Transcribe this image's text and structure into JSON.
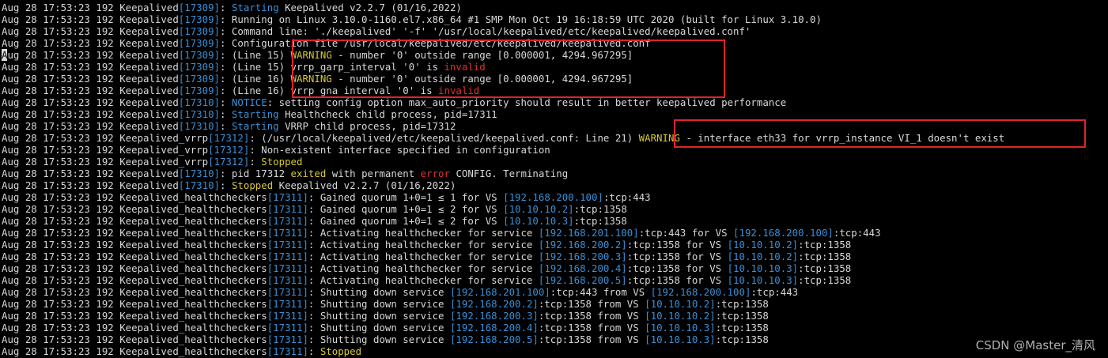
{
  "terminal": {
    "lines": [
      [
        {
          "t": "Aug 28 17:53:23 192 Keepalived",
          "c": "w"
        },
        {
          "t": "[17309]",
          "c": "b"
        },
        {
          "t": ": ",
          "c": "w"
        },
        {
          "t": "Starting",
          "c": "b"
        },
        {
          "t": " Keepalived v2.2.7 (01/16,2022)",
          "c": "w"
        }
      ],
      [
        {
          "t": "Aug 28 17:53:23 192 Keepalived",
          "c": "w"
        },
        {
          "t": "[17309]",
          "c": "b"
        },
        {
          "t": ": Running on Linux 3.10.0-1160.el7.x86_64 #1 SMP Mon Oct 19 16:18:59 UTC 2020 (built for Linux 3.10.0)",
          "c": "w"
        }
      ],
      [
        {
          "t": "Aug 28 17:53:23 192 Keepalived",
          "c": "w"
        },
        {
          "t": "[17309]",
          "c": "b"
        },
        {
          "t": ": Command line: './keepalived' '-f' '/usr/local/keepalived/etc/keepalived/keepalived.conf'",
          "c": "w"
        }
      ],
      [
        {
          "t": "Aug 28 17:53:23 192 Keepalived",
          "c": "w"
        },
        {
          "t": "[17309]",
          "c": "b"
        },
        {
          "t": ": Configuration file /usr/local/keepalived/etc/keepalived/keepalived.conf",
          "c": "w"
        }
      ],
      [
        {
          "t": "A",
          "c": "cursor"
        },
        {
          "t": "ug 28 17:53:23 192 Keepalived",
          "c": "w"
        },
        {
          "t": "[17309]",
          "c": "b"
        },
        {
          "t": ": (Line 15) ",
          "c": "w"
        },
        {
          "t": "WARNING",
          "c": "y"
        },
        {
          "t": " - number '0' outside range [0.000001, 4294.967295]",
          "c": "w"
        }
      ],
      [
        {
          "t": "Aug 28 17:53:23 192 Keepalived",
          "c": "w"
        },
        {
          "t": "[17309]",
          "c": "b"
        },
        {
          "t": ": (Line 15) vrrp_garp_interval '0' is ",
          "c": "w"
        },
        {
          "t": "invalid",
          "c": "r"
        }
      ],
      [
        {
          "t": "Aug 28 17:53:23 192 Keepalived",
          "c": "w"
        },
        {
          "t": "[17309]",
          "c": "b"
        },
        {
          "t": ": (Line 16) ",
          "c": "w"
        },
        {
          "t": "WARNING",
          "c": "y"
        },
        {
          "t": " - number '0' outside range [0.000001, 4294.967295]",
          "c": "w"
        }
      ],
      [
        {
          "t": "Aug 28 17:53:23 192 Keepalived",
          "c": "w"
        },
        {
          "t": "[17309]",
          "c": "b"
        },
        {
          "t": ": (Line 16) vrrp gna interval '0' is ",
          "c": "w"
        },
        {
          "t": "invalid",
          "c": "r"
        }
      ],
      [
        {
          "t": "Aug 28 17:53:23 192 Keepalived",
          "c": "w"
        },
        {
          "t": "[17310]",
          "c": "b"
        },
        {
          "t": ": ",
          "c": "w"
        },
        {
          "t": "NOTICE",
          "c": "b"
        },
        {
          "t": ": setting config option max_auto_priority should result in better keepalived performance",
          "c": "w"
        }
      ],
      [
        {
          "t": "Aug 28 17:53:23 192 Keepalived",
          "c": "w"
        },
        {
          "t": "[17310]",
          "c": "b"
        },
        {
          "t": ": ",
          "c": "w"
        },
        {
          "t": "Starting",
          "c": "b"
        },
        {
          "t": " Healthcheck child process, pid=17311",
          "c": "w"
        }
      ],
      [
        {
          "t": "Aug 28 17:53:23 192 Keepalived",
          "c": "w"
        },
        {
          "t": "[17310]",
          "c": "b"
        },
        {
          "t": ": ",
          "c": "w"
        },
        {
          "t": "Starting",
          "c": "b"
        },
        {
          "t": " VRRP child process, pid=17312",
          "c": "w"
        }
      ],
      [
        {
          "t": "Aug 28 17:53:23 192 Keepalived_vrrp",
          "c": "w"
        },
        {
          "t": "[17312]",
          "c": "b"
        },
        {
          "t": ": (/usr/local/keepalived/etc/keepalived/keepalived.conf: Line 21) ",
          "c": "w"
        },
        {
          "t": "WARNING",
          "c": "y"
        },
        {
          "t": " - interface eth33 for vrrp_instance VI_1 doesn't exist",
          "c": "w"
        }
      ],
      [
        {
          "t": "Aug 28 17:53:23 192 Keepalived_vrrp",
          "c": "w"
        },
        {
          "t": "[17312]",
          "c": "b"
        },
        {
          "t": ": Non-existent interface specified in configuration",
          "c": "w"
        }
      ],
      [
        {
          "t": "Aug 28 17:53:23 192 Keepalived_vrrp",
          "c": "w"
        },
        {
          "t": "[17312]",
          "c": "b"
        },
        {
          "t": ": ",
          "c": "w"
        },
        {
          "t": "Stopped",
          "c": "y"
        }
      ],
      [
        {
          "t": "Aug 28 17:53:23 192 Keepalived",
          "c": "w"
        },
        {
          "t": "[17310]",
          "c": "b"
        },
        {
          "t": ": pid 17312 ",
          "c": "w"
        },
        {
          "t": "exited",
          "c": "y"
        },
        {
          "t": " with permanent ",
          "c": "w"
        },
        {
          "t": "error",
          "c": "r"
        },
        {
          "t": " CONFIG. Terminating",
          "c": "w"
        }
      ],
      [
        {
          "t": "Aug 28 17:53:23 192 Keepalived",
          "c": "w"
        },
        {
          "t": "[17310]",
          "c": "b"
        },
        {
          "t": ": ",
          "c": "w"
        },
        {
          "t": "Stopped",
          "c": "y"
        },
        {
          "t": " Keepalived v2.2.7 (01/16,2022)",
          "c": "w"
        }
      ],
      [
        {
          "t": "Aug 28 17:53:23 192 Keepalived_healthcheckers",
          "c": "w"
        },
        {
          "t": "[17311]",
          "c": "b"
        },
        {
          "t": ": Gained quorum 1+0=1 ≤ 1 for VS ",
          "c": "w"
        },
        {
          "t": "[192.168.200.100]",
          "c": "b"
        },
        {
          "t": ":tcp:443",
          "c": "w"
        }
      ],
      [
        {
          "t": "Aug 28 17:53:23 192 Keepalived_healthcheckers",
          "c": "w"
        },
        {
          "t": "[17311]",
          "c": "b"
        },
        {
          "t": ": Gained quorum 1+0=1 ≤ 2 for VS ",
          "c": "w"
        },
        {
          "t": "[10.10.10.2]",
          "c": "b"
        },
        {
          "t": ":tcp:1358",
          "c": "w"
        }
      ],
      [
        {
          "t": "Aug 28 17:53:23 192 Keepalived_healthcheckers",
          "c": "w"
        },
        {
          "t": "[17311]",
          "c": "b"
        },
        {
          "t": ": Gained quorum 1+0=1 ≤ 2 for VS ",
          "c": "w"
        },
        {
          "t": "[10.10.10.3]",
          "c": "b"
        },
        {
          "t": ":tcp:1358",
          "c": "w"
        }
      ],
      [
        {
          "t": "Aug 28 17:53:23 192 Keepalived_healthcheckers",
          "c": "w"
        },
        {
          "t": "[17311]",
          "c": "b"
        },
        {
          "t": ": Activating healthchecker for service ",
          "c": "w"
        },
        {
          "t": "[192.168.201.100]",
          "c": "b"
        },
        {
          "t": ":tcp:443 for VS ",
          "c": "w"
        },
        {
          "t": "[192.168.200.100]",
          "c": "b"
        },
        {
          "t": ":tcp:443",
          "c": "w"
        }
      ],
      [
        {
          "t": "Aug 28 17:53:23 192 Keepalived_healthcheckers",
          "c": "w"
        },
        {
          "t": "[17311]",
          "c": "b"
        },
        {
          "t": ": Activating healthchecker for service ",
          "c": "w"
        },
        {
          "t": "[192.168.200.2]",
          "c": "b"
        },
        {
          "t": ":tcp:1358 for VS ",
          "c": "w"
        },
        {
          "t": "[10.10.10.2]",
          "c": "b"
        },
        {
          "t": ":tcp:1358",
          "c": "w"
        }
      ],
      [
        {
          "t": "Aug 28 17:53:23 192 Keepalived_healthcheckers",
          "c": "w"
        },
        {
          "t": "[17311]",
          "c": "b"
        },
        {
          "t": ": Activating healthchecker for service ",
          "c": "w"
        },
        {
          "t": "[192.168.200.3]",
          "c": "b"
        },
        {
          "t": ":tcp:1358 for VS ",
          "c": "w"
        },
        {
          "t": "[10.10.10.2]",
          "c": "b"
        },
        {
          "t": ":tcp:1358",
          "c": "w"
        }
      ],
      [
        {
          "t": "Aug 28 17:53:23 192 Keepalived_healthcheckers",
          "c": "w"
        },
        {
          "t": "[17311]",
          "c": "b"
        },
        {
          "t": ": Activating healthchecker for service ",
          "c": "w"
        },
        {
          "t": "[192.168.200.4]",
          "c": "b"
        },
        {
          "t": ":tcp:1358 for VS ",
          "c": "w"
        },
        {
          "t": "[10.10.10.3]",
          "c": "b"
        },
        {
          "t": ":tcp:1358",
          "c": "w"
        }
      ],
      [
        {
          "t": "Aug 28 17:53:23 192 Keepalived_healthcheckers",
          "c": "w"
        },
        {
          "t": "[17311]",
          "c": "b"
        },
        {
          "t": ": Activating healthchecker for service ",
          "c": "w"
        },
        {
          "t": "[192.168.200.5]",
          "c": "b"
        },
        {
          "t": ":tcp:1358 for VS ",
          "c": "w"
        },
        {
          "t": "[10.10.10.3]",
          "c": "b"
        },
        {
          "t": ":tcp:1358",
          "c": "w"
        }
      ],
      [
        {
          "t": "Aug 28 17:53:23 192 Keepalived_healthcheckers",
          "c": "w"
        },
        {
          "t": "[17311]",
          "c": "b"
        },
        {
          "t": ": Shutting down service ",
          "c": "w"
        },
        {
          "t": "[192.168.201.100]",
          "c": "b"
        },
        {
          "t": ":tcp:443 from VS ",
          "c": "w"
        },
        {
          "t": "[192.168.200.100]",
          "c": "b"
        },
        {
          "t": ":tcp:443",
          "c": "w"
        }
      ],
      [
        {
          "t": "Aug 28 17:53:23 192 Keepalived_healthcheckers",
          "c": "w"
        },
        {
          "t": "[17311]",
          "c": "b"
        },
        {
          "t": ": Shutting down service ",
          "c": "w"
        },
        {
          "t": "[192.168.200.2]",
          "c": "b"
        },
        {
          "t": ":tcp:1358 from VS ",
          "c": "w"
        },
        {
          "t": "[10.10.10.2]",
          "c": "b"
        },
        {
          "t": ":tcp:1358",
          "c": "w"
        }
      ],
      [
        {
          "t": "Aug 28 17:53:23 192 Keepalived_healthcheckers",
          "c": "w"
        },
        {
          "t": "[17311]",
          "c": "b"
        },
        {
          "t": ": Shutting down service ",
          "c": "w"
        },
        {
          "t": "[192.168.200.3]",
          "c": "b"
        },
        {
          "t": ":tcp:1358 from VS ",
          "c": "w"
        },
        {
          "t": "[10.10.10.2]",
          "c": "b"
        },
        {
          "t": ":tcp:1358",
          "c": "w"
        }
      ],
      [
        {
          "t": "Aug 28 17:53:23 192 Keepalived_healthcheckers",
          "c": "w"
        },
        {
          "t": "[17311]",
          "c": "b"
        },
        {
          "t": ": Shutting down service ",
          "c": "w"
        },
        {
          "t": "[192.168.200.4]",
          "c": "b"
        },
        {
          "t": ":tcp:1358 from VS ",
          "c": "w"
        },
        {
          "t": "[10.10.10.3]",
          "c": "b"
        },
        {
          "t": ":tcp:1358",
          "c": "w"
        }
      ],
      [
        {
          "t": "Aug 28 17:53:23 192 Keepalived_healthcheckers",
          "c": "w"
        },
        {
          "t": "[17311]",
          "c": "b"
        },
        {
          "t": ": Shutting down service ",
          "c": "w"
        },
        {
          "t": "[192.168.200.5]",
          "c": "b"
        },
        {
          "t": ":tcp:1358 from VS ",
          "c": "w"
        },
        {
          "t": "[10.10.10.3]",
          "c": "b"
        },
        {
          "t": ":tcp:1358",
          "c": "w"
        }
      ],
      [
        {
          "t": "Aug 28 17:53:23 192 Keepalived_healthcheckers",
          "c": "w"
        },
        {
          "t": "[17311]",
          "c": "b"
        },
        {
          "t": ": ",
          "c": "w"
        },
        {
          "t": "Stopped",
          "c": "y"
        }
      ]
    ]
  },
  "watermark": "CSDN @Master_清风",
  "colors": {
    "background": "#000000",
    "text": "#d8d8d8",
    "pid_blue": "#3a8fd6",
    "warning_yellow": "#d6c83a",
    "error_red": "#e0312f",
    "highlight_box": "#e0242a"
  }
}
